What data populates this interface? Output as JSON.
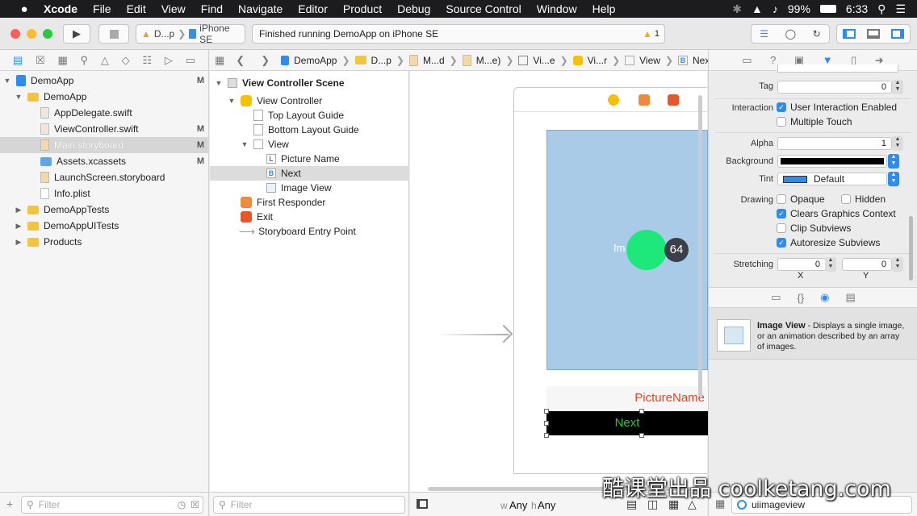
{
  "menubar": {
    "apple": "",
    "items": [
      "Xcode",
      "File",
      "Edit",
      "View",
      "Find",
      "Navigate",
      "Editor",
      "Product",
      "Debug",
      "Source Control",
      "Window",
      "Help"
    ],
    "battery": "99%",
    "time": "6:33"
  },
  "toolbar": {
    "scheme_target": "D...p",
    "scheme_device": "iPhone SE",
    "activity_status": "Finished running DemoApp on iPhone SE",
    "warning_count": "1"
  },
  "jumpbar": {
    "crumbs": [
      "DemoApp",
      "D...p",
      "M...d",
      "M...e)",
      "Vi...e",
      "Vi...r",
      "View",
      "Next"
    ]
  },
  "project_nav": {
    "items": [
      {
        "label": "DemoApp",
        "level": 0,
        "kind": "project",
        "expanded": true,
        "status": "M"
      },
      {
        "label": "DemoApp",
        "level": 1,
        "kind": "folder",
        "expanded": true,
        "status": ""
      },
      {
        "label": "AppDelegate.swift",
        "level": 2,
        "kind": "swift",
        "status": ""
      },
      {
        "label": "ViewController.swift",
        "level": 2,
        "kind": "swift",
        "status": "M"
      },
      {
        "label": "Main.storyboard",
        "level": 2,
        "kind": "storyboard",
        "status": "M",
        "selected": true
      },
      {
        "label": "Assets.xcassets",
        "level": 2,
        "kind": "assets",
        "status": "M"
      },
      {
        "label": "LaunchScreen.storyboard",
        "level": 2,
        "kind": "storyboard",
        "status": ""
      },
      {
        "label": "Info.plist",
        "level": 2,
        "kind": "plist",
        "status": ""
      },
      {
        "label": "DemoAppTests",
        "level": 1,
        "kind": "folder",
        "expanded": false,
        "status": ""
      },
      {
        "label": "DemoAppUITests",
        "level": 1,
        "kind": "folder",
        "expanded": false,
        "status": ""
      },
      {
        "label": "Products",
        "level": 1,
        "kind": "folder",
        "expanded": false,
        "status": ""
      }
    ],
    "filter_placeholder": "Filter"
  },
  "outline": {
    "items": [
      {
        "label": "View Controller Scene",
        "level": 0,
        "bold": true
      },
      {
        "label": "View Controller",
        "level": 1
      },
      {
        "label": "Top Layout Guide",
        "level": 2
      },
      {
        "label": "Bottom Layout Guide",
        "level": 2
      },
      {
        "label": "View",
        "level": 2
      },
      {
        "label": "Picture Name",
        "level": 3,
        "badge": "L"
      },
      {
        "label": "Next",
        "level": 3,
        "badge": "B",
        "selected": true
      },
      {
        "label": "Image View",
        "level": 3
      },
      {
        "label": "First Responder",
        "level": 1
      },
      {
        "label": "Exit",
        "level": 1
      },
      {
        "label": "Storyboard Entry Point",
        "level": 1
      }
    ],
    "filter_placeholder": "Filter"
  },
  "canvas": {
    "image_view_label": "Image View",
    "badge_number": "64",
    "picture_label": "PictureName",
    "next_button": "Next",
    "size_w": "Any",
    "size_h": "Any",
    "size_w_prefix": "w",
    "size_h_prefix": "h"
  },
  "inspector": {
    "tag_label": "Tag",
    "tag_value": "0",
    "interaction_label": "Interaction",
    "user_interaction": "User Interaction Enabled",
    "multiple_touch": "Multiple Touch",
    "alpha_label": "Alpha",
    "alpha_value": "1",
    "background_label": "Background",
    "tint_label": "Tint",
    "tint_value": "Default",
    "drawing_label": "Drawing",
    "opaque": "Opaque",
    "hidden": "Hidden",
    "clears_graphics": "Clears Graphics Context",
    "clip_subviews": "Clip Subviews",
    "autoresize": "Autoresize Subviews",
    "stretching_label": "Stretching",
    "stretch_x": "0",
    "stretch_y": "0",
    "x_label": "X",
    "y_label": "Y"
  },
  "library": {
    "title": "Image View",
    "desc": " - Displays a single image, or an animation described by an array of images.",
    "search_value": "uiimageview"
  },
  "watermark": "酷课堂出品 coolketang.com",
  "colors": {
    "selection": "#2e8cf0",
    "image_view_fill": "#a9cbe8",
    "label_color": "#e0461c",
    "next_text": "#2ec22e",
    "green_dot": "#1fe87a"
  }
}
